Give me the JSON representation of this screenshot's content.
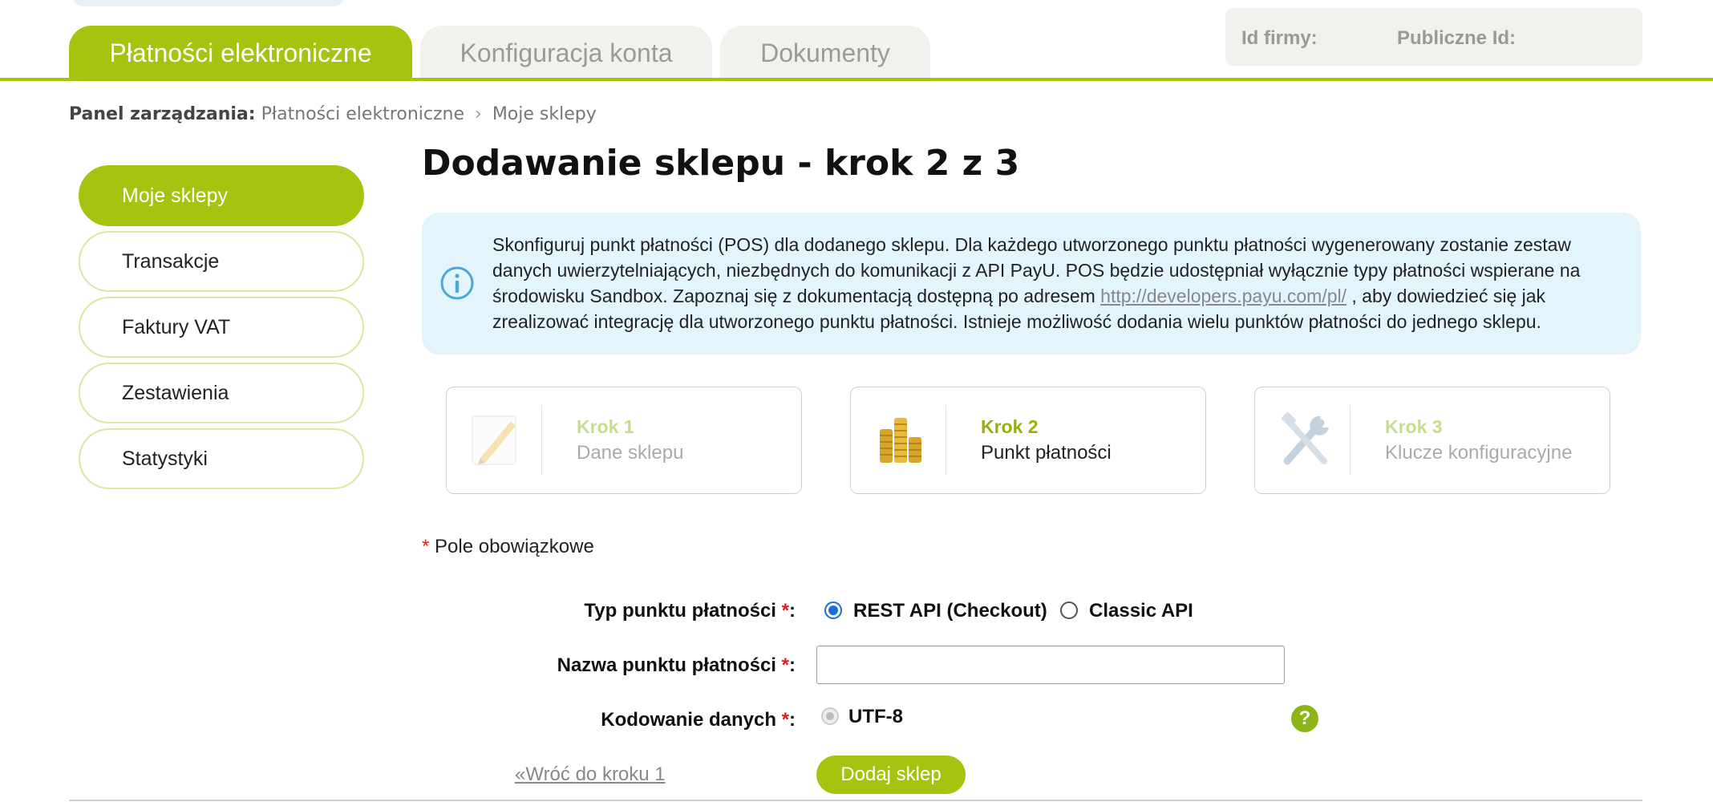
{
  "tabs": {
    "active": "Płatności elektroniczne",
    "config": "Konfiguracja konta",
    "docs": "Dokumenty"
  },
  "ids": {
    "company_label": "Id firmy:",
    "public_label": "Publiczne Id:"
  },
  "breadcrumb": {
    "label": "Panel zarządzania:",
    "item1": "Płatności elektroniczne",
    "separator": "›",
    "item2": "Moje sklepy"
  },
  "sidebar": {
    "items": [
      {
        "label": "Moje sklepy"
      },
      {
        "label": "Transakcje"
      },
      {
        "label": "Faktury VAT"
      },
      {
        "label": "Zestawienia"
      },
      {
        "label": "Statystyki"
      }
    ]
  },
  "page_title": "Dodawanie sklepu - krok 2 z 3",
  "info": {
    "text_before": "Skonfiguruj punkt płatności (POS) dla dodanego sklepu. Dla każdego utworzonego punktu płatności wygenerowany zostanie zestaw danych uwierzytelniających, niezbędnych do komunikacji z API PayU. POS będzie udostępniał wyłącznie typy płatności wspierane na środowisku Sandbox. Zapoznaj się z dokumentacją dostępną po adresem ",
    "link": "http://developers.payu.com/pl/",
    "text_after": " , aby dowiedzieć się jak zrealizować integrację dla utworzonego punktu płatności. Istnieje możliwość dodania wielu punktów płatności do jednego sklepu."
  },
  "steps": [
    {
      "step": "Krok 1",
      "desc": "Dane sklepu",
      "icon": "pencil-icon"
    },
    {
      "step": "Krok 2",
      "desc": "Punkt płatności",
      "icon": "coins-icon"
    },
    {
      "step": "Krok 3",
      "desc": "Klucze konfiguracyjne",
      "icon": "tools-icon"
    }
  ],
  "required_note": "Pole obowiązkowe",
  "form": {
    "pos_type_label": "Typ punktu płatności",
    "pos_type_options": [
      "REST API (Checkout)",
      "Classic API"
    ],
    "pos_type_selected": "REST API (Checkout)",
    "pos_name_label": "Nazwa punktu płatności",
    "pos_name_value": "",
    "encoding_label": "Kodowanie danych",
    "encoding_option": "UTF-8",
    "required_marker": "*",
    "colon": ":",
    "help_glyph": "?"
  },
  "actions": {
    "back": "«Wróć do kroku 1",
    "submit": "Dodaj sklep"
  },
  "colors": {
    "accent": "#a6c40f",
    "info_bg": "#e4f4fb",
    "required": "#e31b23"
  }
}
